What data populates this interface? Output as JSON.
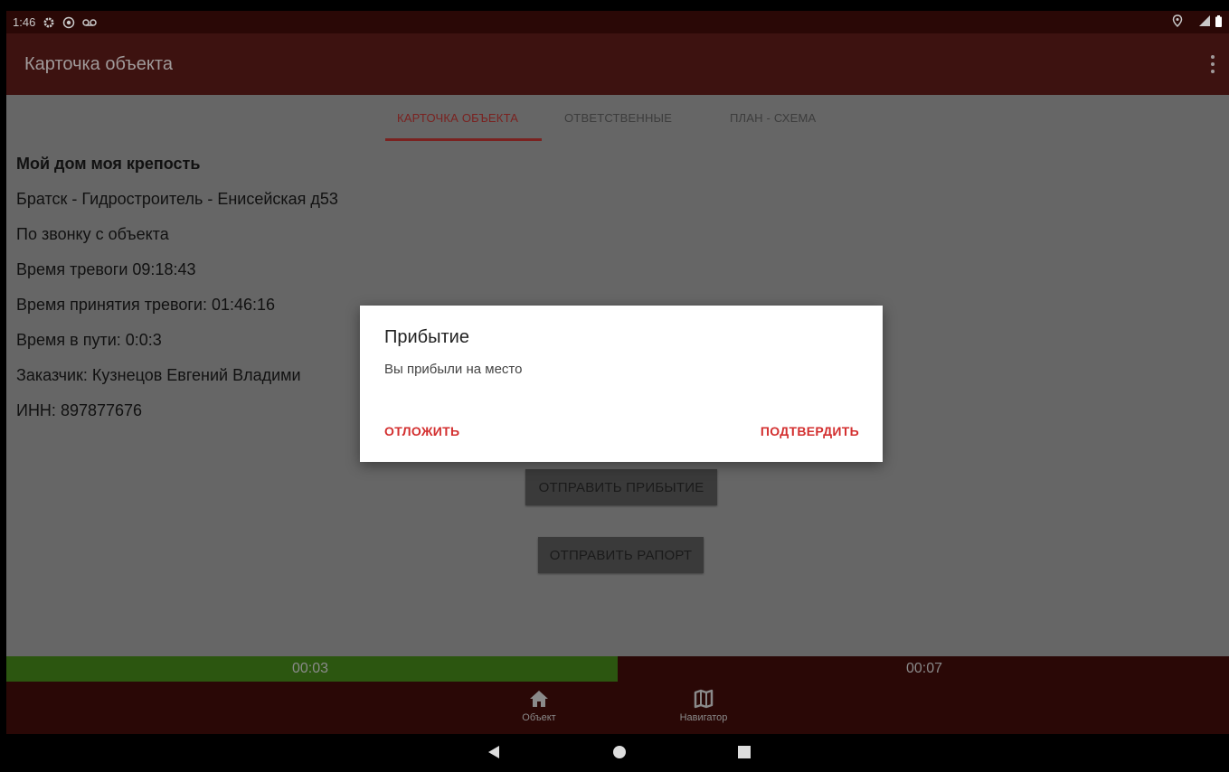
{
  "status_bar": {
    "time": "1:46"
  },
  "app_bar": {
    "title": "Карточка объекта"
  },
  "tabs": [
    {
      "label": "КАРТОЧКА ОБЪЕКТА",
      "active": true
    },
    {
      "label": "ОТВЕТСТВЕННЫЕ",
      "active": false
    },
    {
      "label": "ПЛАН - СХЕМА",
      "active": false
    }
  ],
  "object_info": {
    "name": "Мой дом моя крепость",
    "address": "Братск - Гидростроитель - Енисейская д53",
    "source": "По звонку с объекта",
    "alarm_time": "Время тревоги 09:18:43",
    "accept_time": "Время принятия тревоги: 01:46:16",
    "travel_time": "Время в пути: 0:0:3",
    "customer": "Заказчик: Кузнецов Евгений Владими",
    "inn": "ИНН: 897877676"
  },
  "buttons": {
    "send_arrival": "ОТПРАВИТЬ ПРИБЫТИЕ",
    "send_report": "ОТПРАВИТЬ РАПОРТ"
  },
  "dialog": {
    "title": "Прибытие",
    "message": "Вы прибыли на место",
    "postpone": "ОТЛОЖИТЬ",
    "confirm": "ПОДТВЕРДИТЬ"
  },
  "timer": {
    "elapsed": "00:03",
    "remaining": "00:07",
    "progress_fraction": 0.5
  },
  "bottom_nav": [
    {
      "label": "Объект",
      "icon": "home-icon"
    },
    {
      "label": "Навигатор",
      "icon": "map-icon"
    }
  ],
  "colors": {
    "app_bar": "#3d1210",
    "status_bar": "#2a0806",
    "accent": "#7a2220",
    "dialog_action": "#d32f2f",
    "progress_fill": "#2c5610"
  }
}
